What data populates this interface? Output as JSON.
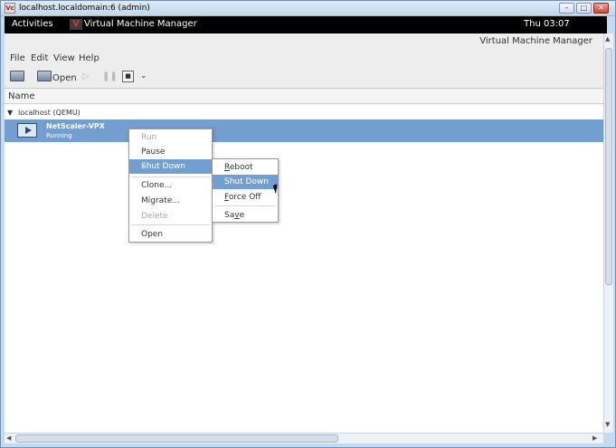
{
  "vnc_window": {
    "title": "localhost.localdomain:6 (admin)",
    "icon_label": "Vc",
    "buttons": [
      "minimize",
      "maximize",
      "close"
    ]
  },
  "panel": {
    "activities": "Activities",
    "app_name": "Virtual Machine Manager",
    "clock": "Thu 03:07"
  },
  "app": {
    "title": "Virtual Machine Manager",
    "menu": [
      "File",
      "Edit",
      "View",
      "Help"
    ],
    "toolbar": {
      "open_label": "Open"
    },
    "columns": {
      "name": "Name"
    },
    "host": {
      "label": "localhost (QEMU)"
    },
    "vm": {
      "name": "NetScaler-VPX",
      "state": "Running"
    }
  },
  "context_menu": {
    "items": [
      {
        "label": "Run",
        "enabled": false
      },
      {
        "label": "Pause",
        "enabled": true
      },
      {
        "label": "Shut Down",
        "enabled": true,
        "highlighted": true,
        "submenu": true
      },
      {
        "label": "Clone...",
        "enabled": true
      },
      {
        "label": "Migrate...",
        "enabled": true
      },
      {
        "label": "Delete",
        "enabled": false
      },
      {
        "label": "Open",
        "enabled": true
      }
    ]
  },
  "submenu": {
    "items": [
      {
        "label": "Reboot",
        "mnemonic": "R",
        "rest": "eboot"
      },
      {
        "label": "Shut Down",
        "highlighted": true
      },
      {
        "label": "Force Off",
        "mnemonic": "F",
        "rest": "orce Off"
      },
      {
        "label": "Save",
        "pre": "Sa",
        "mnemonic": "v",
        "rest": "e"
      }
    ]
  },
  "colors": {
    "selection": "#729fcf",
    "panel": "#000000",
    "window_chrome": "#c6d9ee"
  }
}
